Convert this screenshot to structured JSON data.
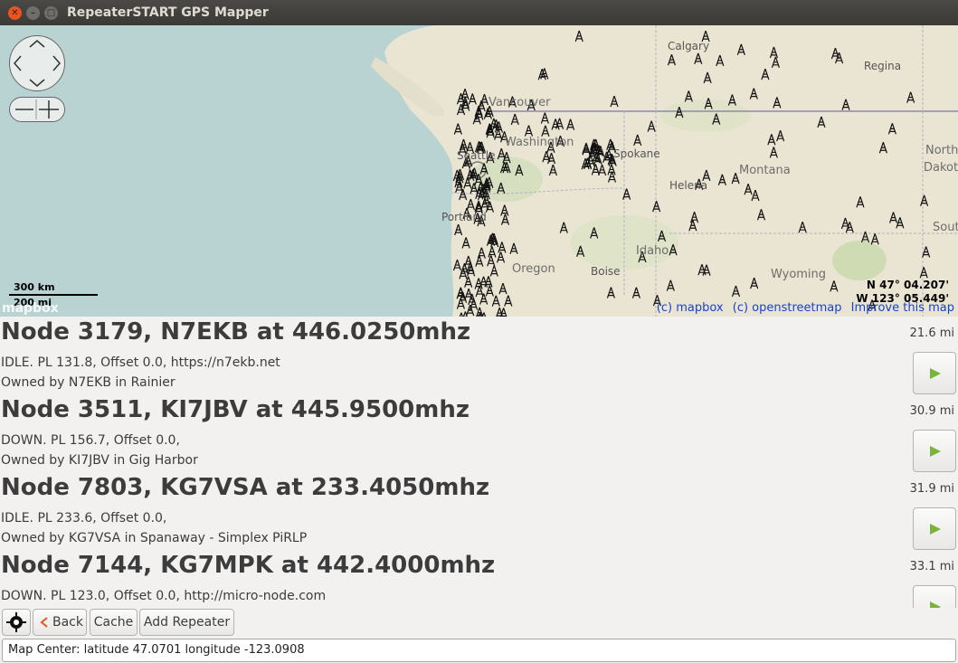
{
  "window": {
    "title": "RepeaterSTART GPS Mapper"
  },
  "map": {
    "labels": {
      "calgary": "Calgary",
      "regina": "Regina",
      "vancouver": "Vancouver",
      "washington": "Washington",
      "seattle": "Seattle",
      "spokane": "Spokane",
      "montana": "Montana",
      "helena": "Helena",
      "north_dakota_1": "North",
      "north_dakota_2": "Dakot",
      "portland": "Portland",
      "idaho": "Idaho",
      "oregon": "Oregon",
      "boise": "Boise",
      "wyoming": "Wyoming",
      "south_dakota": "Sout"
    },
    "scale": {
      "km": "300 km",
      "mi": "200 mi"
    },
    "coords": {
      "lat": "N 47° 04.207'",
      "lon": "W 123° 05.449'"
    },
    "logo": "mapbox",
    "attribution": {
      "mapbox": "(c) mapbox",
      "osm": "(c) openstreetmap",
      "improve": "Improve this map"
    }
  },
  "nodes": [
    {
      "title": "Node 3179, N7EKB at 446.0250mhz",
      "line1": "IDLE. PL 131.8, Offset 0.0, https://n7ekb.net",
      "line2": "Owned by N7EKB in Rainier",
      "distance": "21.6 mi"
    },
    {
      "title": "Node 3511, KI7JBV at 445.9500mhz",
      "line1": "DOWN. PL 156.7, Offset 0.0,",
      "line2": "Owned by KI7JBV in Gig Harbor",
      "distance": "30.9 mi"
    },
    {
      "title": "Node 7803, KG7VSA at 233.4050mhz",
      "line1": "IDLE. PL 233.6, Offset 0.0,",
      "line2": "Owned by KG7VSA in Spanaway - Simplex PiRLP",
      "distance": "31.9 mi"
    },
    {
      "title": "Node 7144, KG7MPK at 442.4000mhz",
      "line1": "DOWN. PL 123.0, Offset 0.0, http://micro-node.com",
      "line2": "",
      "distance": "33.1 mi"
    }
  ],
  "toolbar": {
    "back": "Back",
    "cache": "Cache",
    "add_repeater": "Add Repeater"
  },
  "status": "Map Center: latitude 47.0701 longitude -123.0908",
  "colors": {
    "water": "#b9d3d2",
    "land": "#eae5d3",
    "link": "#1a3fd0",
    "play": "#7ab23a",
    "close": "#e95420"
  }
}
